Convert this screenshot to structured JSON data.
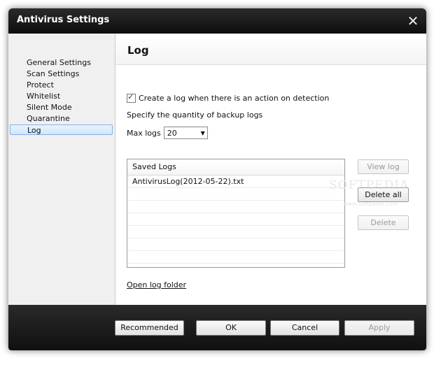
{
  "window": {
    "title": "Antivirus Settings"
  },
  "sidebar": {
    "items": [
      {
        "label": "General Settings",
        "active": false
      },
      {
        "label": "Scan Settings",
        "active": false
      },
      {
        "label": "Protect",
        "active": false
      },
      {
        "label": "Whitelist",
        "active": false
      },
      {
        "label": "Silent Mode",
        "active": false
      },
      {
        "label": "Quarantine",
        "active": false
      },
      {
        "label": "Log",
        "active": true
      }
    ]
  },
  "panel": {
    "title": "Log",
    "create_log_label": "Create a log when there is an action on detection",
    "create_log_checked": true,
    "backup_label": "Specify the quantity of backup logs",
    "max_logs_label": "Max logs",
    "max_logs_value": "20",
    "saved_logs_header": "Saved Logs",
    "saved_logs": [
      "AntivirusLog(2012-05-22).txt"
    ],
    "view_log_label": "View log",
    "delete_all_label": "Delete all",
    "delete_label": "Delete",
    "open_folder_label": "Open log folder"
  },
  "watermark": {
    "text": "SOFTPEDIA",
    "sub": "www.softpedia.com"
  },
  "footer": {
    "recommended_label": "Recommended",
    "ok_label": "OK",
    "cancel_label": "Cancel",
    "apply_label": "Apply"
  },
  "icons": {
    "close": "close-icon",
    "checkbox": "check-icon",
    "dropdown": "chevron-down-icon"
  }
}
